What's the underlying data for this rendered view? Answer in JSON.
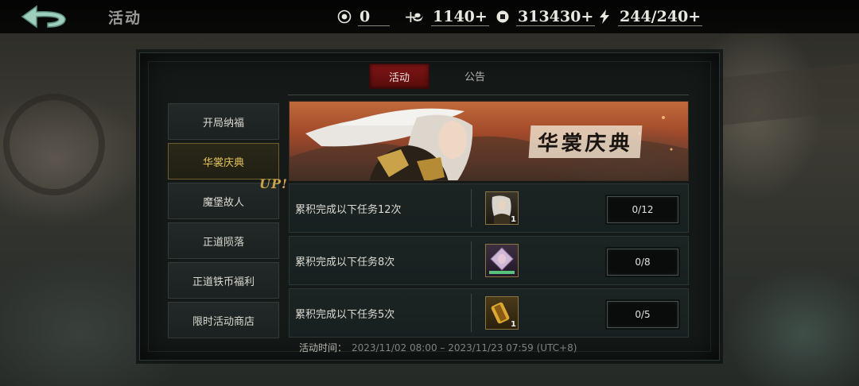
{
  "header": {
    "title": "活动",
    "resources": [
      {
        "icon": "coin-token-icon",
        "value": "0",
        "plus": "+"
      },
      {
        "icon": "silver-ingot-icon",
        "value": "1140+"
      },
      {
        "icon": "copper-coin-icon",
        "value": "313430+"
      },
      {
        "icon": "stamina-lightning-icon",
        "value": "244/240+"
      }
    ]
  },
  "tabs": [
    {
      "label": "活动",
      "active": true
    },
    {
      "label": "公告",
      "active": false
    }
  ],
  "sidebar": {
    "items": [
      {
        "label": "开局纳福",
        "active": false
      },
      {
        "label": "华裳庆典",
        "active": true
      },
      {
        "label": "魔堡故人",
        "active": false
      },
      {
        "label": "正道陨落",
        "active": false
      },
      {
        "label": "正道铁币福利",
        "active": false
      },
      {
        "label": "限时活动商店",
        "active": false
      }
    ],
    "badge": "UP!"
  },
  "banner": {
    "title": "华裳庆典"
  },
  "tasks": [
    {
      "label": "累积完成以下任务12次",
      "reward_icon": "character-portrait-icon",
      "reward_qty": "1",
      "progress": "0/12"
    },
    {
      "label": "累积完成以下任务8次",
      "reward_icon": "character-shard-icon",
      "reward_qty": "",
      "progress": "0/8"
    },
    {
      "label": "累积完成以下任务5次",
      "reward_icon": "golden-scroll-icon",
      "reward_qty": "1",
      "progress": "0/5"
    }
  ],
  "footer": {
    "label": "活动时间：",
    "value": "2023/11/02 08:00 – 2023/11/23 07:59 (UTC+8)"
  },
  "colors": {
    "active_tab": "#7d1515",
    "active_sidebar_text": "#e6c45a",
    "banner_orange": "#c06a3c"
  }
}
